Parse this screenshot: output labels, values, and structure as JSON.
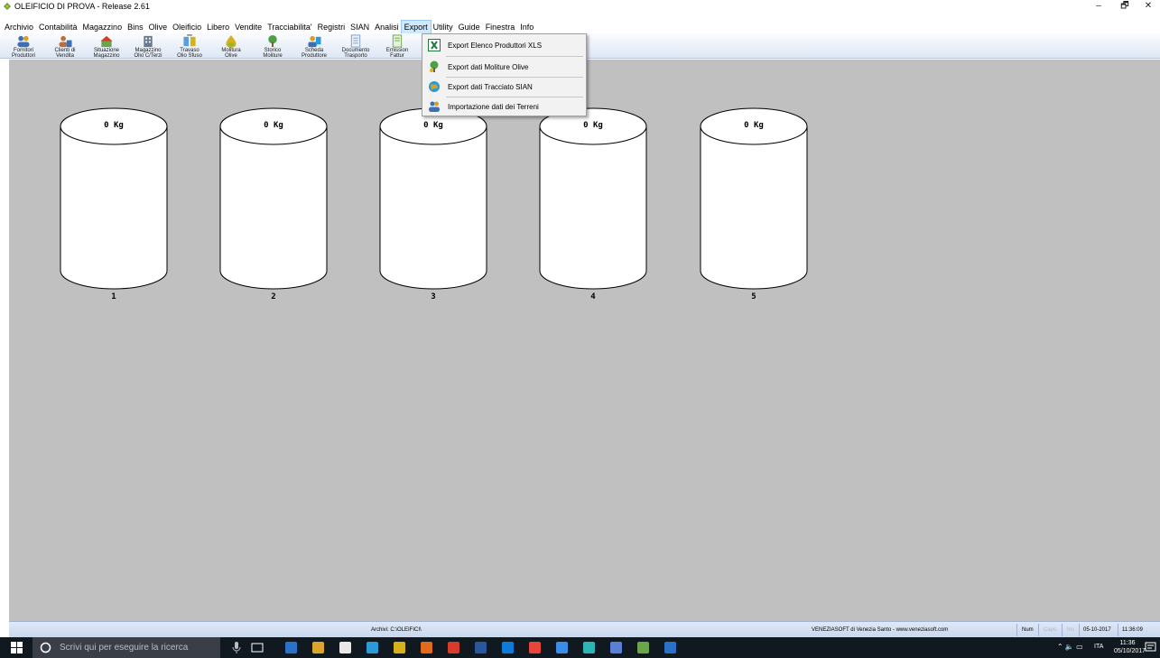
{
  "window": {
    "title": "OLEIFICIO DI PROVA - Release 2.61",
    "controls": [
      "–",
      "🗗",
      "✕"
    ]
  },
  "menu": [
    "Archivio",
    "Contabilità",
    "Magazzino",
    "Bins",
    "Olive",
    "Oleificio",
    "Libero",
    "Vendite",
    "Tracciabilita'",
    "Registri",
    "SIAN",
    "Analisi",
    "Export",
    "Utility",
    "Guide",
    "Finestra",
    "Info"
  ],
  "toolbar": [
    {
      "label": "Fornitori\nProduttori",
      "icon": "users-icon",
      "color": "#3d6fb7"
    },
    {
      "label": "Clienti di\nVendita",
      "icon": "clients-icon",
      "color": "#b7703d"
    },
    {
      "label": "Situazione\nMagazzino",
      "icon": "warehouse-icon",
      "color": "#6aa54a"
    },
    {
      "label": "Magazzino\nOlio C/Terzi",
      "icon": "building-icon",
      "color": "#6a7a8c"
    },
    {
      "label": "Travaso\nOlio Sfuso",
      "icon": "transfer-icon",
      "color": "#5a9fd6"
    },
    {
      "label": "Molitura\nOlive",
      "icon": "oil-drop-icon",
      "color": "#d6b21a"
    },
    {
      "label": "Storico\nMoliture",
      "icon": "history-icon",
      "color": "#4f9e4a"
    },
    {
      "label": "Scheda\nProduttore",
      "icon": "producer-card-icon",
      "color": "#3d6fb7"
    },
    {
      "label": "Documento\nTrasporto",
      "icon": "document-icon",
      "color": "#7a9ac4"
    },
    {
      "label": "Emission\nFattur",
      "icon": "invoice-icon",
      "color": "#6aa54a"
    }
  ],
  "export_menu": {
    "items": [
      {
        "label": "Export Elenco Produttori XLS",
        "icon": "excel-icon"
      },
      {
        "label": "Export dati Moliture Olive",
        "icon": "olive-tree-icon"
      },
      {
        "label": "Export dati Tracciato SIAN",
        "icon": "globe-icon"
      },
      {
        "label": "Importazione dati dei Terreni",
        "icon": "users-import-icon"
      }
    ]
  },
  "tanks": [
    {
      "kg": "0 Kg",
      "number": "1"
    },
    {
      "kg": "0 Kg",
      "number": "2"
    },
    {
      "kg": "0 Kg",
      "number": "3"
    },
    {
      "kg": "0 Kg",
      "number": "4"
    },
    {
      "kg": "0 Kg",
      "number": "5"
    }
  ],
  "status": {
    "archive": "Archivi: C:\\OLEIFICI\\",
    "company": "VENEZIASOFT di Venezia Santo - www.veneziasoft.com",
    "num": "Num",
    "caps": "Caps",
    "ins": "Ins",
    "date": "05-10-2017",
    "time": "11:36:09"
  },
  "taskbar": {
    "search_placeholder": "Scrivi qui per eseguire la ricerca",
    "lang": "ITA",
    "clock_time": "11:36",
    "clock_date": "05/10/2017",
    "app_colors": [
      "#2a72c8",
      "#d9a52a",
      "#e8e8e8",
      "#2a9ad8",
      "#d6b21a",
      "#e26a1c",
      "#d83b2a",
      "#2b579a",
      "#0f7bd8",
      "#e8463a",
      "#3a8ee6",
      "#2bb5b5",
      "#5a7fd6",
      "#6aa54a",
      "#2a72c8"
    ]
  }
}
